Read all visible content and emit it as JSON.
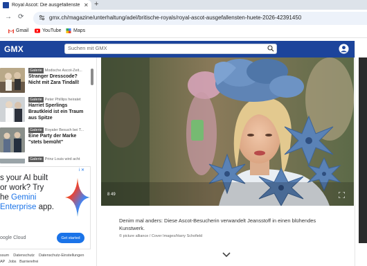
{
  "browser": {
    "tab_title": "Royal Ascot: Die ausgefallenste",
    "new_tab": "+",
    "url": "gmx.ch/magazine/unterhaltung/adel/britische-royals/royal-ascot-ausgefallensten-huete-2026-42391450",
    "bookmarks": [
      "Gmail",
      "YouTube",
      "Maps"
    ]
  },
  "gmx": {
    "logo": "GMX",
    "search_placeholder": "Suchen mit GMX"
  },
  "sidebar": {
    "articles": [
      {
        "badge": "Galerie",
        "kicker": "Modische Ascot-Zeit...",
        "headline": "Stranger Dresscode? Nicht mit Zara Tindall!"
      },
      {
        "badge": "Galerie",
        "kicker": "Peter Phillips heiratet",
        "headline": "Harriet Sperlings Brautkleid ist ein Traum aus Spitze"
      },
      {
        "badge": "Galerie",
        "kicker": "Royaler Besuch bei T...",
        "headline": "Eine Party der Marke \"stets bemüht\""
      },
      {
        "badge": "Galerie",
        "kicker": "Prinz Louis wird acht",
        "headline": ""
      }
    ],
    "ad": {
      "line1": "s your AI built",
      "line2": "or work? Try",
      "line3a": "he ",
      "line3b": "Gemini",
      "line4": "Enterprise",
      "line4b": " app.",
      "brand": "oogle Cloud",
      "cta": "Get started",
      "info": "i ✕"
    },
    "footer": {
      "row1": [
        "ssum",
        "Datenschutz",
        "Datenschutz-Einstellungen"
      ],
      "row2": [
        "AP",
        "Jobs",
        "Barrierefrei"
      ]
    }
  },
  "main": {
    "photo_counter": "8 49",
    "caption": "Denim mal anders: Diese Ascot-Besucherin verwandelt Jeansstoff in einen blühendes Kunstwerk.",
    "credit": "© picture alliance / Cover Images/Harry Schofield"
  },
  "colors": {
    "gmx_blue": "#1c449b",
    "chrome_gray": "#dde3ea",
    "gemini_blue": "#1a73e8"
  }
}
